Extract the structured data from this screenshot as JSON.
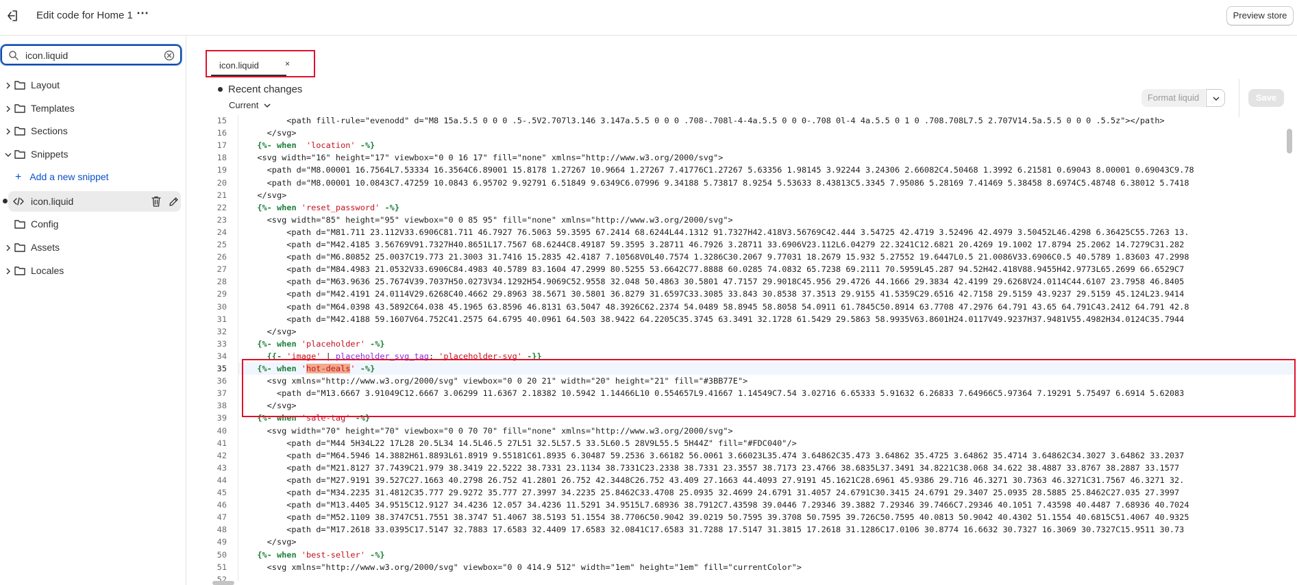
{
  "topbar": {
    "title": "Edit code for Home 1",
    "more_label": "⋯",
    "preview_label": "Preview store"
  },
  "sidebar": {
    "search_value": "icon.liquid",
    "items": [
      {
        "label": "Layout",
        "expanded": false
      },
      {
        "label": "Templates",
        "expanded": false
      },
      {
        "label": "Sections",
        "expanded": false
      },
      {
        "label": "Snippets",
        "expanded": true
      },
      {
        "label": "Config",
        "expanded": false
      },
      {
        "label": "Assets",
        "expanded": false
      },
      {
        "label": "Locales",
        "expanded": false
      }
    ],
    "add_snippet_label": "Add a new snippet",
    "file_label": "icon.liquid"
  },
  "editor": {
    "tab_label": "icon.liquid",
    "tab_close": "×",
    "recent_changes": "Recent changes",
    "version_label": "Current",
    "format_label": "Format liquid",
    "save_label": "Save",
    "line_numbers": [
      "15",
      "16",
      "17",
      "18",
      "19",
      "20",
      "21",
      "22",
      "23",
      "24",
      "25",
      "26",
      "27",
      "28",
      "29",
      "30",
      "31",
      "32",
      "33",
      "34",
      "35",
      "36",
      "37",
      "38",
      "39",
      "40",
      "41",
      "42",
      "43",
      "44",
      "45",
      "46",
      "47",
      "48",
      "49",
      "50",
      "51",
      "52"
    ],
    "current_line": "35",
    "lines": [
      "        <path fill-rule=\"evenodd\" d=\"M8 15a.5.5 0 0 0 .5-.5V2.707l3.146 3.147a.5.5 0 0 0 .708-.708l-4-4a.5.5 0 0 0-.708 0l-4 4a.5.5 0 1 0 .708.708L7.5 2.707V14.5a.5.5 0 0 0 .5.5z\"></path>",
      "    </svg>",
      "  {%- when  'location' -%}",
      "  <svg width=\"16\" height=\"17\" viewbox=\"0 0 16 17\" fill=\"none\" xmlns=\"http://www.w3.org/2000/svg\">",
      "    <path d=\"M8.00001 16.7564L7.53334 16.3564C6.89001 15.8178 1.27267 10.9664 1.27267 7.41776C1.27267 5.63356 1.98145 3.92244 3.24306 2.66082C4.50468 1.3992 6.21581 0.69043 8.00001 0.69043C9.78",
      "    <path d=\"M8.00001 10.0843C7.47259 10.0843 6.95702 9.92791 6.51849 9.6349C6.07996 9.34188 5.73817 8.9254 5.53633 8.43813C5.3345 7.95086 5.28169 7.41469 5.38458 8.6974C5.48748 6.38012 5.7418",
      "  </svg>",
      "  {%- when 'reset_password' -%}",
      "    <svg width=\"85\" height=\"95\" viewbox=\"0 0 85 95\" fill=\"none\" xmlns=\"http://www.w3.org/2000/svg\">",
      "        <path d=\"M81.711 23.112V33.6906C81.711 46.7927 76.5063 59.3595 67.2414 68.6244L44.1312 91.7327H42.418V3.56769C42.444 3.54725 42.4719 3.52496 42.4979 3.50452L46.4298 6.36425C55.7263 13.",
      "        <path d=\"M42.4185 3.56769V91.7327H40.8651L17.7567 68.6244C8.49187 59.3595 3.28711 46.7926 3.28711 33.6906V23.112L6.04279 22.3241C12.6821 20.4269 19.1002 17.8794 25.2062 14.7279C31.282",
      "        <path d=\"M6.80852 25.0037C19.773 21.3003 31.7416 15.2835 42.4187 7.10568V0L40.7574 1.3286C30.2067 9.77031 18.2679 15.932 5.27552 19.6447L0.5 21.0086V33.6906C0.5 40.5789 1.83603 47.2998",
      "        <path d=\"M84.4983 21.0532V33.6906C84.4983 40.5789 83.1604 47.2999 80.5255 53.6642C77.8888 60.0285 74.0832 65.7238 69.2111 70.5959L45.287 94.52H42.418V88.9455H42.9773L65.2699 66.6529C7",
      "        <path d=\"M63.9636 25.7674V39.7037H50.0273V34.1292H54.9069C52.9558 32.048 50.4863 30.5801 47.7157 29.9018C45.956 29.4726 44.1666 29.3834 42.4199 29.6268V24.0114C44.6107 23.7958 46.8405",
      "        <path d=\"M42.4191 24.0114V29.6268C40.4662 29.8963 38.5671 30.5801 36.8279 31.6597C33.3085 33.843 30.8538 37.3513 29.9155 41.5359C29.6516 42.7158 29.5159 43.9237 29.5159 45.124L23.9414",
      "        <path d=\"M64.0398 43.5892C64.038 45.1965 63.8596 46.8131 63.5047 48.3926C62.2374 54.0489 58.8945 58.8058 54.0911 61.7845C50.8914 63.7708 47.2976 64.791 43.65 64.791C43.2412 64.791 42.8",
      "        <path d=\"M42.4188 59.1607V64.752C41.2575 64.6795 40.0961 64.503 38.9422 64.2205C35.3745 63.3491 32.1728 61.5429 29.5863 58.9935V63.8601H24.0117V49.9237H37.9481V55.4982H34.0124C35.7944",
      "    </svg>",
      "  {%- when 'placeholder' -%}",
      "    {{- 'image' | placeholder_svg_tag: 'placeholder-svg' -}}",
      "  {%- when 'hot-deals' -%}",
      "    <svg xmlns=\"http://www.w3.org/2000/svg\" viewbox=\"0 0 20 21\" width=\"20\" height=\"21\" fill=\"#3BB77E\">",
      "      <path d=\"M13.6667 3.91049C12.6667 3.06299 11.6367 2.18382 10.5942 1.14466L10 0.554657L9.41667 1.14549C7.54 3.02716 6.65333 5.91632 6.26833 7.64966C5.97364 7.19291 5.75497 6.6914 5.62083",
      "    </svg>",
      "  {%- when 'sale-tag' -%}",
      "    <svg width=\"70\" height=\"70\" viewbox=\"0 0 70 70\" fill=\"none\" xmlns=\"http://www.w3.org/2000/svg\">",
      "        <path d=\"M44 5H34L22 17L28 20.5L34 14.5L46.5 27L51 32.5L57.5 33.5L60.5 28V9L55.5 5H44Z\" fill=\"#FDC040\"/>",
      "        <path d=\"M64.5946 14.3882H61.8893L61.8919 9.55181C61.8935 6.30487 59.2536 3.66182 56.0061 3.66023L35.474 3.64862C35.473 3.64862 35.4725 3.64862 35.4714 3.64862C34.3027 3.64862 33.2037",
      "        <path d=\"M21.8127 37.7439C21.979 38.3419 22.5222 38.7331 23.1134 38.7331C23.2338 38.7331 23.3557 38.7173 23.4766 38.6835L37.3491 34.8221C38.068 34.622 38.4887 33.8767 38.2887 33.1577",
      "        <path d=\"M27.9191 39.527C27.1663 40.2798 26.752 41.2801 26.752 42.3448C26.752 43.409 27.1663 44.4093 27.9191 45.1621C28.6961 45.9386 29.716 46.3271 30.7363 46.3271C31.7567 46.3271 32.",
      "        <path d=\"M34.2235 31.4812C35.777 29.9272 35.777 27.3997 34.2235 25.8462C33.4708 25.0935 32.4699 24.6791 31.4057 24.6791C30.3415 24.6791 29.3407 25.0935 28.5885 25.8462C27.035 27.3997",
      "        <path d=\"M13.4405 34.9515C12.9127 34.4236 12.057 34.4236 11.5291 34.9515L7.68936 38.7912C7.43598 39.0446 7.29346 39.3882 7.29346 39.7466C7.29346 40.1051 7.43598 40.4487 7.68936 40.7024",
      "        <path d=\"M52.1109 38.3747C51.7551 38.3747 51.4067 38.5193 51.1554 38.7706C50.9042 39.0219 50.7595 39.3708 50.7595 39.726C50.7595 40.0813 50.9042 40.4302 51.1554 40.6815C51.4067 40.9325",
      "        <path d=\"M17.2618 33.0395C17.5147 32.7883 17.6583 32.4409 17.6583 32.0841C17.6583 31.7288 17.5147 31.3815 17.2618 31.1286C17.0106 30.8774 16.6632 30.7327 16.3069 30.7327C15.9511 30.73",
      "    </svg>",
      "  {%- when 'best-seller' -%}",
      "    <svg xmlns=\"http://www.w3.org/2000/svg\" viewbox=\"0 0 414.9 512\" width=\"1em\" height=\"1em\" fill=\"currentColor\">",
      ""
    ]
  }
}
